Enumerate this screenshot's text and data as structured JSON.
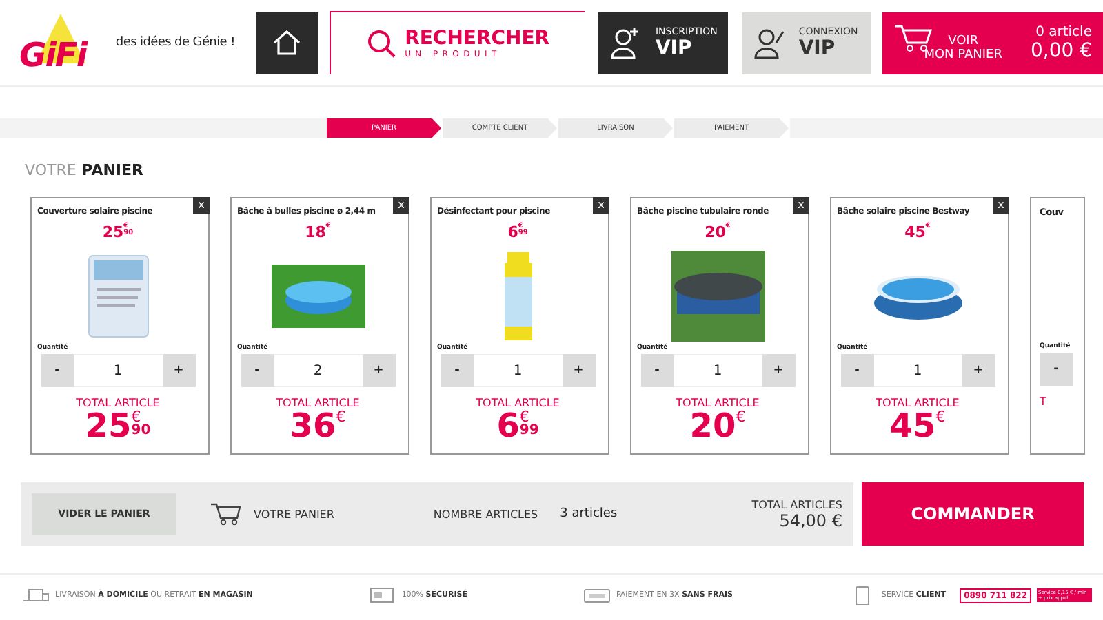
{
  "header": {
    "logo": "GiFi",
    "tagline": "des idées de Génie !",
    "search": {
      "line1": "RECHERCHER",
      "line2": "UN PRODUIT"
    },
    "vip_signup": {
      "small": "INSCRIPTION",
      "big": "VIP"
    },
    "vip_login": {
      "small": "CONNEXION",
      "big": "VIP"
    },
    "cart": {
      "line1": "VOIR",
      "line2": "MON PANIER",
      "count": "0 article",
      "total": "0,00 €"
    }
  },
  "steps": [
    {
      "label": "PANIER",
      "selected": true
    },
    {
      "label": "COMPTE CLIENT",
      "selected": false
    },
    {
      "label": "LIVRAISON",
      "selected": false
    },
    {
      "label": "PAIEMENT",
      "selected": false
    }
  ],
  "page_title": {
    "light": "VOTRE",
    "bold": "PANIER"
  },
  "items": [
    {
      "name": "Couverture solaire piscine",
      "price": {
        "units": "25",
        "currency": "€",
        "cents": "90"
      },
      "quantity_label": "Quantité",
      "minus": "-",
      "quantity": "1",
      "plus": "+",
      "total_label": "TOTAL ARTICLE",
      "total": {
        "units": "25",
        "currency": "€",
        "cents": "90"
      },
      "close": "x"
    },
    {
      "name": "Bâche à bulles piscine ø 2,44 m",
      "price": {
        "units": "18",
        "currency": "€"
      },
      "quantity_label": "Quantité",
      "minus": "-",
      "quantity": "2",
      "plus": "+",
      "total_label": "TOTAL ARTICLE",
      "total": {
        "units": "36",
        "currency": "€"
      },
      "close": "x"
    },
    {
      "name": "Désinfectant pour piscine",
      "price": {
        "units": "6",
        "currency": "€",
        "cents": "99"
      },
      "quantity_label": "Quantité",
      "minus": "-",
      "quantity": "1",
      "plus": "+",
      "total_label": "TOTAL ARTICLE",
      "total": {
        "units": "6",
        "currency": "€",
        "cents": "99"
      },
      "close": "x"
    },
    {
      "name": "Bâche piscine tubulaire ronde",
      "price": {
        "units": "20",
        "currency": "€"
      },
      "quantity_label": "Quantité",
      "minus": "-",
      "quantity": "1",
      "plus": "+",
      "total_label": "TOTAL ARTICLE",
      "total": {
        "units": "20",
        "currency": "€"
      },
      "close": "x"
    },
    {
      "name": "Bâche solaire piscine Bestway",
      "price": {
        "units": "45",
        "currency": "€"
      },
      "quantity_label": "Quantité",
      "minus": "-",
      "quantity": "1",
      "plus": "+",
      "total_label": "TOTAL ARTICLE",
      "total": {
        "units": "45",
        "currency": "€"
      },
      "close": "x"
    }
  ],
  "partial_item": {
    "name": "Couv",
    "quantity_label": "Quantité",
    "minus": "-",
    "total_label": "T"
  },
  "summary": {
    "empty_button": "VIDER LE PANIER",
    "cart_label": "VOTRE PANIER",
    "count_label": "NOMBRE ARTICLES",
    "count": "3 articles",
    "total_label": "TOTAL ARTICLES",
    "total": "54,00 €",
    "order_button": "COMMANDER"
  },
  "footer": [
    {
      "kind": "truck",
      "text": "LIVRAISON **À DOMICILE** OU RETRAIT **EN MAGASIN**"
    },
    {
      "kind": "lock",
      "text": "100% **SÉCURISÉ**"
    },
    {
      "kind": "card",
      "text": "PAIEMENT EN 3X **SANS FRAIS**"
    },
    {
      "kind": "phone",
      "text": "SERVICE **CLIENT**",
      "phone": "0890 711 822",
      "note": "Service 0,15 € / min + prix appel"
    }
  ]
}
